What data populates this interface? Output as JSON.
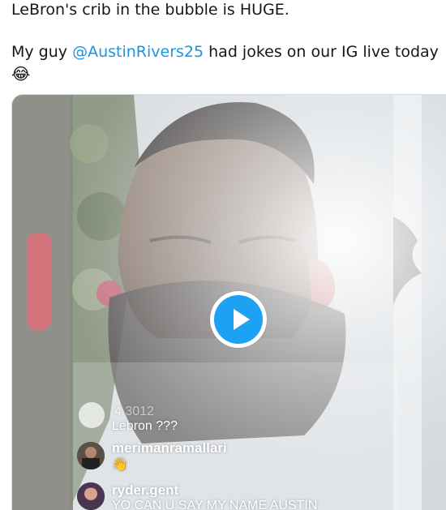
{
  "tweet": {
    "line1": "LeBron's crib in the bubble is HUGE.",
    "line2_prefix": "My guy ",
    "mention": "@AustinRivers25",
    "line2_suffix": " had jokes on our IG live today",
    "emoji": "😂"
  },
  "video": {
    "play_icon": "play-icon",
    "accent_color": "#1da1f2",
    "overlay": {
      "partial_count": "4.3012",
      "comment1": {
        "text": "Lebron ???"
      },
      "comment2": {
        "username": "merimanramallari",
        "text": "👋"
      },
      "comment3": {
        "username": "ryder.gent",
        "text": "YO CAN U SAY MY NAME AUSTIN"
      }
    }
  }
}
